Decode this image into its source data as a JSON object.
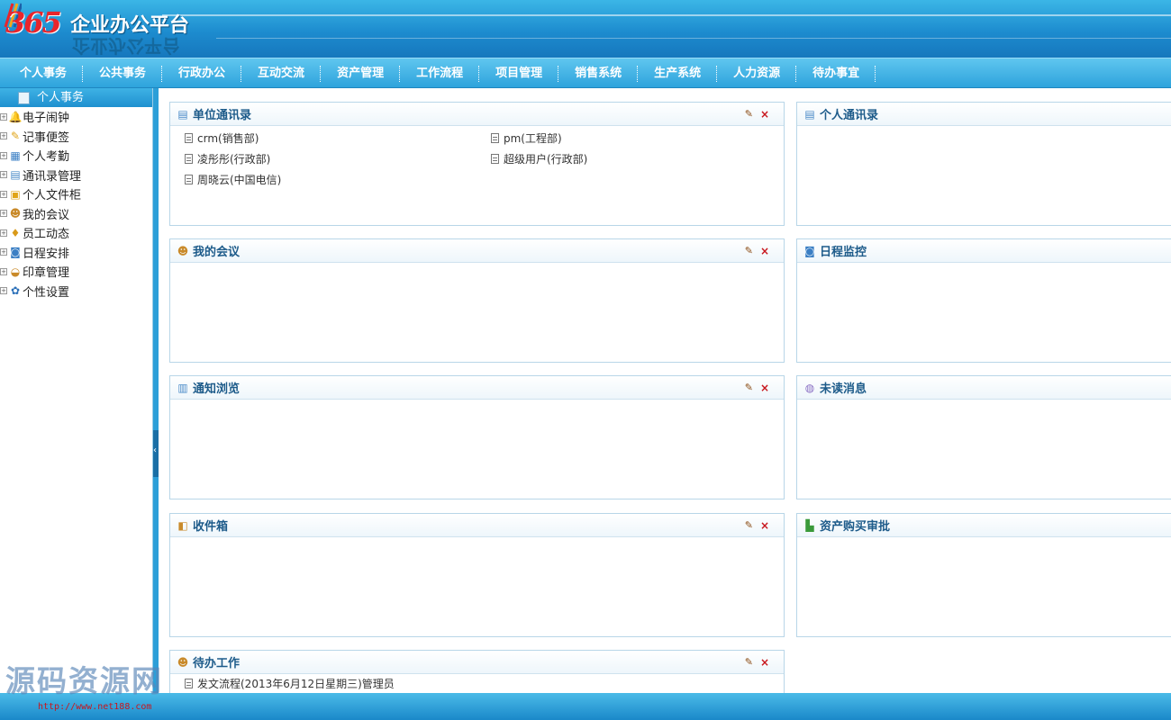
{
  "app": {
    "logo_number": "365",
    "title": "企业办公平台",
    "title_reflection": "企业办公平台"
  },
  "nav": {
    "items": [
      "个人事务",
      "公共事务",
      "行政办公",
      "互动交流",
      "资产管理",
      "工作流程",
      "项目管理",
      "销售系统",
      "生产系统",
      "人力资源",
      "待办事宜"
    ]
  },
  "sidebar": {
    "header": "个人事务",
    "items": [
      {
        "label": "电子闹钟",
        "icon": "bell-icon"
      },
      {
        "label": "记事便签",
        "icon": "note-icon"
      },
      {
        "label": "个人考勤",
        "icon": "calendar-icon"
      },
      {
        "label": "通讯录管理",
        "icon": "address-book-icon"
      },
      {
        "label": "个人文件柜",
        "icon": "file-cabinet-icon"
      },
      {
        "label": "我的会议",
        "icon": "meeting-icon"
      },
      {
        "label": "员工动态",
        "icon": "staff-icon"
      },
      {
        "label": "日程安排",
        "icon": "schedule-icon"
      },
      {
        "label": "印章管理",
        "icon": "seal-icon"
      },
      {
        "label": "个性设置",
        "icon": "settings-icon"
      }
    ]
  },
  "panels": {
    "company_contacts": {
      "title": "单位通讯录",
      "entries": [
        "crm(销售部)",
        "pm(工程部)",
        "凌彤彤(行政部)",
        "超级用户(行政部)",
        "周晓云(中国电信)"
      ]
    },
    "personal_contacts": {
      "title": "个人通讯录"
    },
    "my_meetings": {
      "title": "我的会议"
    },
    "schedule_monitor": {
      "title": "日程监控"
    },
    "notice_browse": {
      "title": "通知浏览"
    },
    "unread_messages": {
      "title": "未读消息"
    },
    "inbox": {
      "title": "收件箱"
    },
    "asset_purchase": {
      "title": "资产购买审批"
    },
    "todo_work": {
      "title": "待办工作",
      "entries": [
        "发文流程(2013年6月12日星期三)管理员"
      ]
    }
  },
  "panel_tools": {
    "edit": "✎",
    "close": "×"
  },
  "watermark": {
    "text": "源码资源网",
    "url": "http://www.net188.com"
  }
}
